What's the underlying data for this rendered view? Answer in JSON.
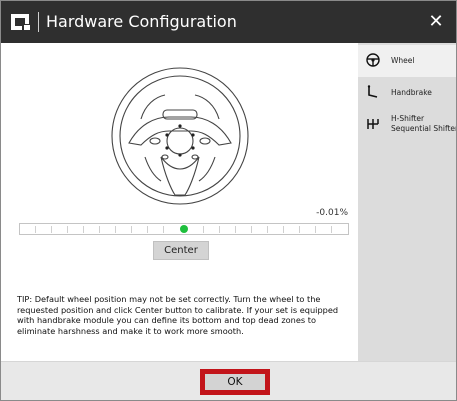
{
  "window": {
    "title": "Hardware Configuration",
    "close_symbol": "✕"
  },
  "sidebar": {
    "items": [
      {
        "label": "Wheel",
        "icon": "steering-wheel-icon",
        "active": true
      },
      {
        "label": "Handbrake",
        "icon": "handbrake-icon",
        "active": false
      },
      {
        "label": "H-Shifter\nSequential Shifter",
        "icon": "shifter-icon",
        "active": false
      }
    ]
  },
  "main": {
    "wheel_position_percent": "-0.01%",
    "slider_level_fraction": 0.5,
    "center_button_label": "Center",
    "tip_text": "TIP: Default wheel position may not be set correctly. Turn the wheel to the requested position and click Center button to calibrate. If your set is equipped with handbrake module you can define its bottom and top dead zones to eliminate harshness and make it to work more smooth."
  },
  "footer": {
    "ok_label": "OK"
  },
  "colors": {
    "titlebar": "#2f2f2f",
    "sidebar": "#dcdcdc",
    "indicator": "#1fbf3d",
    "highlight": "#c2141a"
  }
}
